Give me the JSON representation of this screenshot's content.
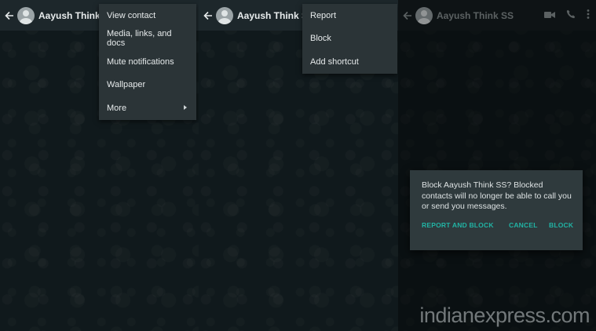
{
  "contact": {
    "name": "Aayush Think SS"
  },
  "panel1": {
    "menu": [
      {
        "label": "View contact"
      },
      {
        "label": "Media, links, and docs"
      },
      {
        "label": "Mute notifications"
      },
      {
        "label": "Wallpaper"
      },
      {
        "label": "More",
        "has_submenu": true
      }
    ]
  },
  "panel2": {
    "menu": [
      {
        "label": "Report"
      },
      {
        "label": "Block"
      },
      {
        "label": "Add shortcut"
      }
    ]
  },
  "panel3": {
    "dialog": {
      "message": "Block Aayush Think SS? Blocked contacts will no longer be able to call you or send you messages.",
      "report_and_block": "REPORT AND BLOCK",
      "cancel": "CANCEL",
      "block": "BLOCK"
    }
  },
  "icons": [
    "back-arrow-icon",
    "avatar-icon",
    "video-call-icon",
    "phone-icon",
    "more-vertical-icon"
  ],
  "colors": {
    "accent": "#21b3a4",
    "header": "#1d272b",
    "menu": "#2b3437"
  },
  "watermark": "indianexpress.com"
}
